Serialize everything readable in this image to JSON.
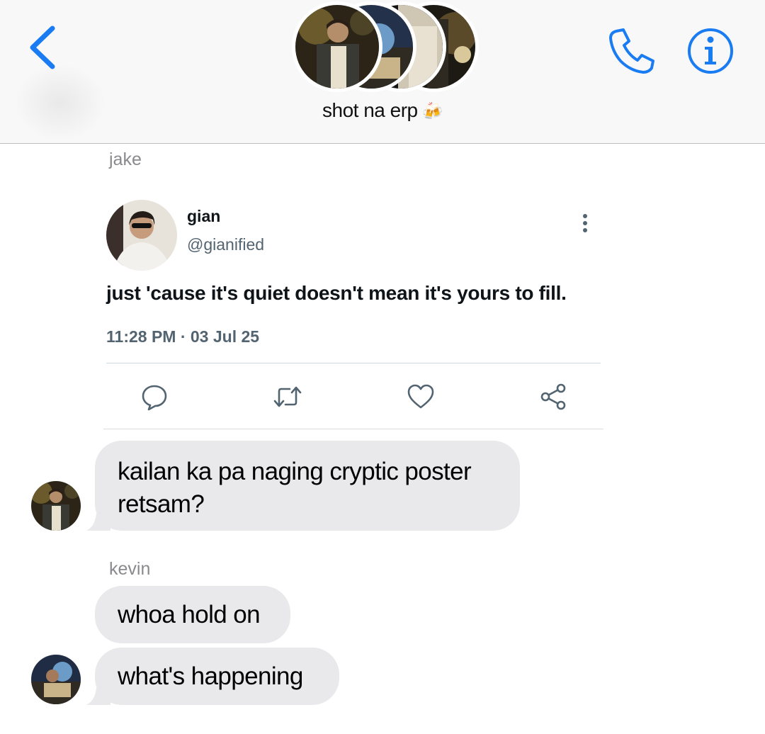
{
  "header": {
    "group_title": "shot na erp",
    "title_emoji": "🍻",
    "icons": [
      "chevron-left-icon",
      "phone-icon",
      "info-icon"
    ],
    "accent_color": "#1a7cf2"
  },
  "messages": [
    {
      "sender": "jake",
      "tweet": {
        "display_name": "gian",
        "handle": "@gianified",
        "text": "just 'cause it's quiet doesn't mean it's yours to fill.",
        "timestamp": "11:28 PM · 03 Jul 25",
        "actions": [
          "reply-icon",
          "retweet-icon",
          "like-icon",
          "share-icon"
        ]
      },
      "bubble_lines": [
        "kailan ka pa naging cryptic poster",
        "retsam?"
      ]
    },
    {
      "sender": "kevin",
      "bubbles": [
        "whoa hold on",
        "what's happening"
      ]
    }
  ],
  "colors": {
    "bubble_gray": "#e9e9eb",
    "sender_gray": "#8a8a8e",
    "tweet_secondary": "#536471"
  }
}
